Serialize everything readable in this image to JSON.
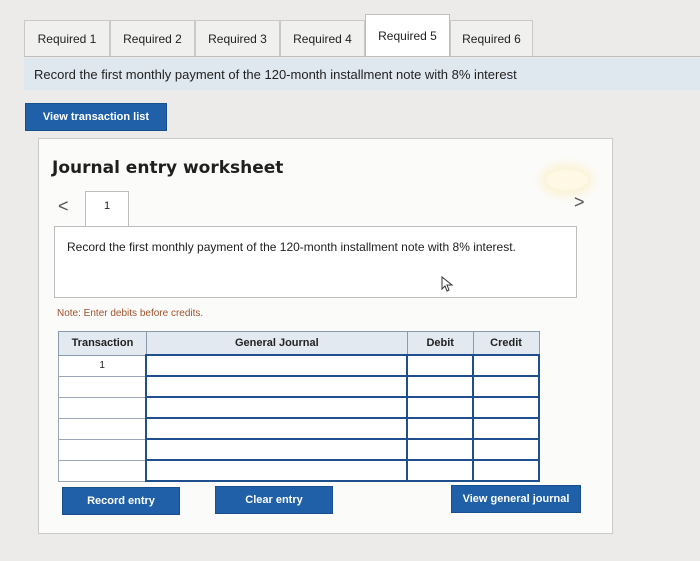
{
  "tabs": [
    "Required 1",
    "Required 2",
    "Required 3",
    "Required 4",
    "Required 5",
    "Required 6"
  ],
  "active_tab": "Required 5",
  "banner": "Record the first monthly payment of the 120-month installment note with 8% interest",
  "buttons": {
    "view_transaction_list": "View transaction list",
    "record_entry": "Record entry",
    "clear_entry": "Clear entry",
    "view_general_journal": "View general journal"
  },
  "worksheet": {
    "title": "Journal entry worksheet",
    "entry_number": "1",
    "prev_glyph": "<",
    "next_glyph": ">",
    "description": "Record the first monthly payment of the 120-month installment note with 8% interest.",
    "note": "Note: Enter debits before credits."
  },
  "table": {
    "headers": {
      "transaction": "Transaction",
      "general_journal": "General Journal",
      "debit": "Debit",
      "credit": "Credit"
    },
    "rows": [
      {
        "transaction": "1",
        "account": "",
        "debit": "",
        "credit": ""
      },
      {
        "transaction": "",
        "account": "",
        "debit": "",
        "credit": ""
      },
      {
        "transaction": "",
        "account": "",
        "debit": "",
        "credit": ""
      },
      {
        "transaction": "",
        "account": "",
        "debit": "",
        "credit": ""
      },
      {
        "transaction": "",
        "account": "",
        "debit": "",
        "credit": ""
      },
      {
        "transaction": "",
        "account": "",
        "debit": "",
        "credit": ""
      }
    ]
  },
  "colors": {
    "primary_button": "#1f60a8",
    "banner_bg": "#dfe7ef",
    "note_text": "#a0522d"
  }
}
